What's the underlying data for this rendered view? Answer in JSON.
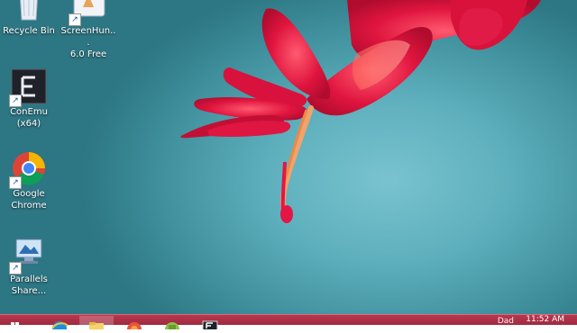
{
  "desktop": {
    "icons": [
      {
        "label_line1": "Recycle Bin",
        "label_line2": ""
      },
      {
        "label_line1": "ScreenHun...",
        "label_line2": "6.0 Free"
      },
      {
        "label_line1": "ConEmu",
        "label_line2": "(x64)"
      },
      {
        "label_line1": "Google",
        "label_line2": "Chrome"
      },
      {
        "label_line1": "Parallels",
        "label_line2": "Share..."
      }
    ]
  },
  "taskbar": {
    "apps": [
      "start-button",
      "internet-explorer-icon",
      "file-explorer-icon",
      "screenhunter-icon",
      "android-icon",
      "conemu-icon"
    ],
    "clock_time": "11:52 AM",
    "tray_partial": "Dad"
  },
  "colors": {
    "taskbar": "#a52d43",
    "background": "#4fa3b0",
    "flower": "#e21745"
  }
}
